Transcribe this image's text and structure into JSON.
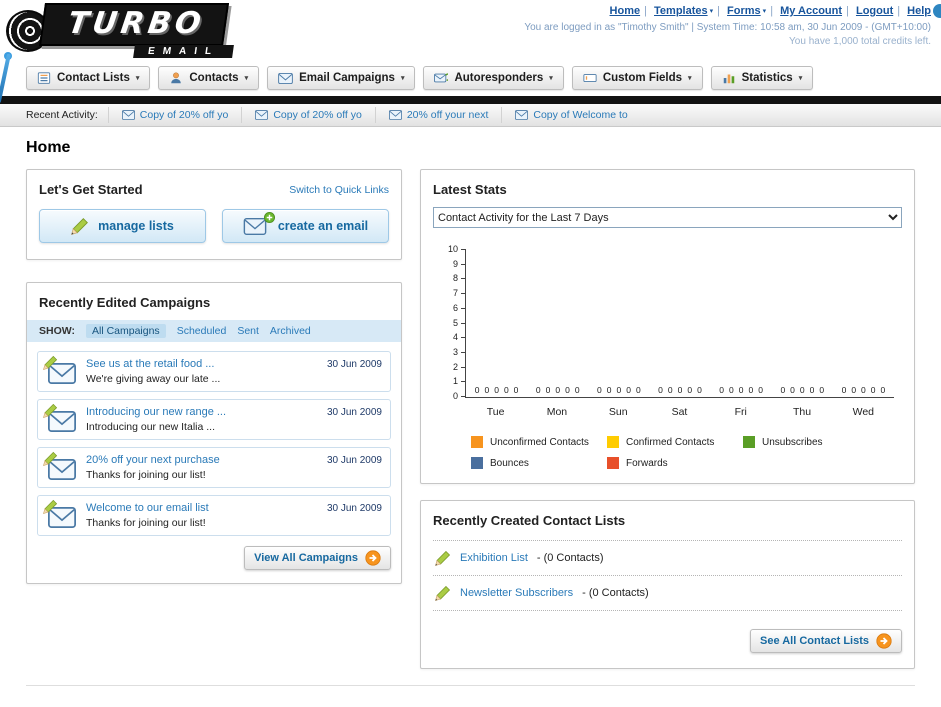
{
  "icons": {
    "chevron_down": "▾"
  },
  "header": {
    "logo_title": "TURBO",
    "logo_subtitle": "EMAIL",
    "nav_links": [
      "Home",
      "Templates",
      "Forms",
      "My Account",
      "Logout",
      "Help"
    ],
    "status_line1": "You are logged in as \"Timothy Smith\" | System Time: 10:58 am, 30 Jun 2009 - (GMT+10:00)",
    "status_line2": "You have 1,000 total credits left."
  },
  "main_nav": [
    {
      "label": "Contact Lists"
    },
    {
      "label": "Contacts"
    },
    {
      "label": "Email Campaigns"
    },
    {
      "label": "Autoresponders"
    },
    {
      "label": "Custom Fields"
    },
    {
      "label": "Statistics"
    }
  ],
  "recent_activity": {
    "label": "Recent Activity:",
    "items": [
      "Copy of 20% off yo",
      "Copy of 20% off yo",
      "20% off your next",
      "Copy of Welcome to"
    ]
  },
  "page_title": "Home",
  "get_started": {
    "title": "Let's Get Started",
    "switch_link": "Switch to Quick Links",
    "manage_lists_label": "manage lists",
    "create_email_label": "create an email"
  },
  "campaigns": {
    "title": "Recently Edited Campaigns",
    "show_label": "SHOW:",
    "tabs": [
      "All Campaigns",
      "Scheduled",
      "Sent",
      "Archived"
    ],
    "items": [
      {
        "title": "See us at the retail food ...",
        "subtitle": "We're giving away our late ...",
        "date": "30 Jun 2009"
      },
      {
        "title": "Introducing our new range ...",
        "subtitle": "Introducing our new Italia ...",
        "date": "30 Jun 2009"
      },
      {
        "title": "20% off your next purchase",
        "subtitle": "Thanks for joining our list!",
        "date": "30 Jun 2009"
      },
      {
        "title": "Welcome to our email list",
        "subtitle": "Thanks for joining our list!",
        "date": "30 Jun 2009"
      }
    ],
    "view_all_label": "View All Campaigns"
  },
  "stats": {
    "title": "Latest Stats",
    "dropdown_value": "Contact Activity for the Last 7 Days",
    "legend": [
      {
        "label": "Unconfirmed Contacts",
        "color": "#f7941e"
      },
      {
        "label": "Confirmed Contacts",
        "color": "#ffcc00"
      },
      {
        "label": "Unsubscribes",
        "color": "#5a9e26"
      },
      {
        "label": "Bounces",
        "color": "#4a6f9e"
      },
      {
        "label": "Forwards",
        "color": "#e8502a"
      }
    ]
  },
  "chart_data": {
    "type": "bar",
    "title": "Contact Activity for the Last 7 Days",
    "categories": [
      "Tue",
      "Mon",
      "Sun",
      "Sat",
      "Fri",
      "Thu",
      "Wed"
    ],
    "series": [
      {
        "name": "Unconfirmed Contacts",
        "values": [
          0,
          0,
          0,
          0,
          0,
          0,
          0
        ]
      },
      {
        "name": "Confirmed Contacts",
        "values": [
          0,
          0,
          0,
          0,
          0,
          0,
          0
        ]
      },
      {
        "name": "Unsubscribes",
        "values": [
          0,
          0,
          0,
          0,
          0,
          0,
          0
        ]
      },
      {
        "name": "Bounces",
        "values": [
          0,
          0,
          0,
          0,
          0,
          0,
          0
        ]
      },
      {
        "name": "Forwards",
        "values": [
          0,
          0,
          0,
          0,
          0,
          0,
          0
        ]
      }
    ],
    "xlabel": "",
    "ylabel": "",
    "ylim": [
      0,
      10
    ],
    "yticks": [
      0,
      1,
      2,
      3,
      4,
      5,
      6,
      7,
      8,
      9,
      10
    ],
    "grid": false,
    "legend_position": "bottom"
  },
  "contact_lists": {
    "title": "Recently Created Contact Lists",
    "items": [
      {
        "name": "Exhibition List",
        "detail": "- (0 Contacts)"
      },
      {
        "name": "Newsletter Subscribers",
        "detail": "- (0 Contacts)"
      }
    ],
    "see_all_label": "See All Contact Lists"
  }
}
